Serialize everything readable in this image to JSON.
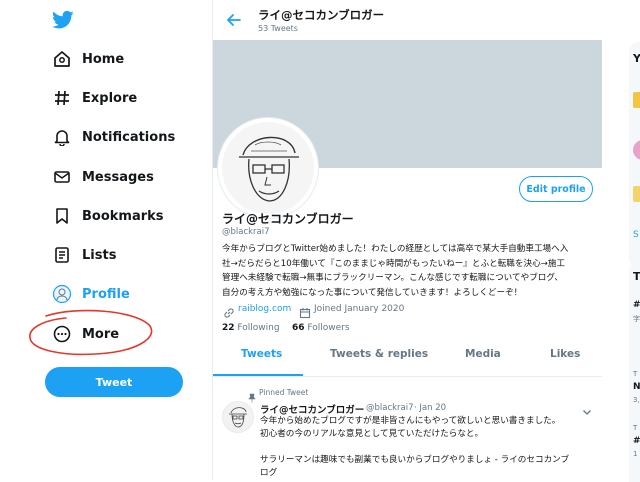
{
  "nav": {
    "items": [
      {
        "label": "Home",
        "icon": "home-icon"
      },
      {
        "label": "Explore",
        "icon": "hashtag-icon"
      },
      {
        "label": "Notifications",
        "icon": "bell-icon"
      },
      {
        "label": "Messages",
        "icon": "envelope-icon"
      },
      {
        "label": "Bookmarks",
        "icon": "bookmark-icon"
      },
      {
        "label": "Lists",
        "icon": "list-icon"
      },
      {
        "label": "Profile",
        "icon": "profile-icon"
      },
      {
        "label": "More",
        "icon": "more-icon"
      }
    ],
    "tweet_button": "Tweet",
    "accent": "#1da1f2",
    "annotation_color": "#e0392b"
  },
  "header": {
    "name": "ライ@セコカンブロガー",
    "tweet_count": "53 Tweets"
  },
  "profile": {
    "edit_button": "Edit profile",
    "name": "ライ@セコカンブロガー",
    "handle": "@blackrai7",
    "bio_lines": [
      "今年からブログとTwitter始めました！わたしの経歴としては高卒で某大手自動車工場へ入",
      "社→だらだらと10年働いて『このままじゃ時間がもったいねー』とふと転職を決心→施工",
      "管理へ未経験で転職→無事にブラックリーマン。こんな感じです転職についてやブログ、",
      "自分の考え方や勉強になった事について発信していきます！よろしくどーぞ！"
    ],
    "website": "raiblog.com",
    "joined": "Joined January 2020",
    "following_count": "22",
    "following_label": "Following",
    "followers_count": "66",
    "followers_label": "Followers"
  },
  "tabs": [
    "Tweets",
    "Tweets & replies",
    "Media",
    "Likes"
  ],
  "pinned": {
    "label": "Pinned Tweet",
    "name": "ライ@セコカンブロガー",
    "handle": "@blackrai7",
    "date": "· Jan 20",
    "lines": [
      "今年から始めたブログですが是非皆さんにもやって欲しいと思い書きました。",
      "初心者の今のリアルな意見として見ていただけたらなと。",
      "",
      "サラリーマンは趣味でも副業でも良いからブログやりましょ - ライのセコカンブ",
      "ログ"
    ]
  },
  "right_fragments": [
    "Y",
    "S",
    "T",
    "#",
    "字",
    "T",
    "N",
    "3,",
    "T",
    "#",
    "1"
  ]
}
